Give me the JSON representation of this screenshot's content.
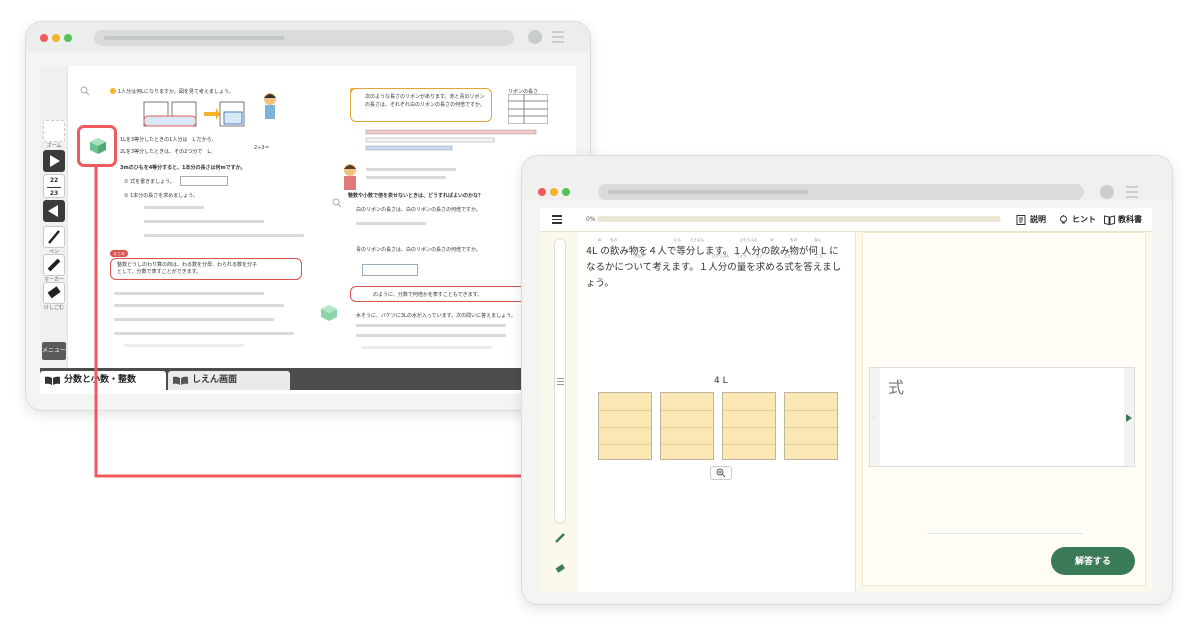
{
  "textbook_window": {
    "toolbar": {
      "select_label": "ズーム",
      "page_upper": "22",
      "page_lower": "23",
      "pen_label": "ペン",
      "marker_label": "マーカー",
      "eraser_label": "けしごむ",
      "menu_label": "メニュー"
    },
    "page": {
      "q1_text": "1人分は何Lになりますか。図を見て考えましょう。",
      "q1_line2": "1Lを3等分したときの1人分は　L だから、",
      "q1_line3": "2Lを3等分したときは、その2つ分で　L。",
      "q1_formula": "2÷3＝",
      "q3_text": "3mのひもを4等分すると、1本分の長さは何mですか。",
      "q3_step1": "① 式を書きましょう。",
      "q3_step2": "② 1本分の長さを求めましょう。",
      "rule_tag": "まとめ",
      "rule_text": "整数どうしのわり算の商は、わる数を分母、わられる数を分子として、分数で表すことができます。",
      "q2_text": "次のような長さのリボンがあります。赤と青のリボンの長さは、それぞれ白のリボンの長さの何倍ですか。",
      "q2_table_title": "リボンの長さ",
      "q2_sub1": "白のリボンの長さは、白のリボンの長さの何倍ですか。",
      "q2_sub2": "青のリボンの長さは、白のリボンの長さの何倍ですか。",
      "q2_rule": "整数や小数で倍を表せないときは、どうすればよいのかな？",
      "q2_rule2": "のように、分数で何倍かを表すこともできます。",
      "bottom_note": "水そうに、バケツに3Lの水が入っています。次の問いに答えましょう。"
    },
    "tabs": [
      {
        "label": "分数と小数・整数"
      },
      {
        "label": "しえん画面"
      }
    ]
  },
  "practice_window": {
    "progress_label": "0%",
    "progress": 0,
    "buttons": {
      "explain": "説明",
      "hint": "ヒント",
      "textbook": "教科書"
    },
    "question": "4L の飲み物を４人で等分します。１人分の飲み物が何 L になるかについて考えます。１人分の量を求める式を答えましょう。",
    "ruby": [
      "の",
      "もの",
      "にん",
      "とうぶん",
      "ひとりぶん",
      "の",
      "もの",
      "なん",
      "かんが",
      "ひとりぶん",
      "りょう",
      "もと",
      "しき",
      "こた"
    ],
    "figure_label": "4 L",
    "cup_count": 4,
    "zoom_icon": "magnifier-plus-icon",
    "answer_label": "式",
    "submit_label": "解答する",
    "accent": "#3b7a57"
  }
}
